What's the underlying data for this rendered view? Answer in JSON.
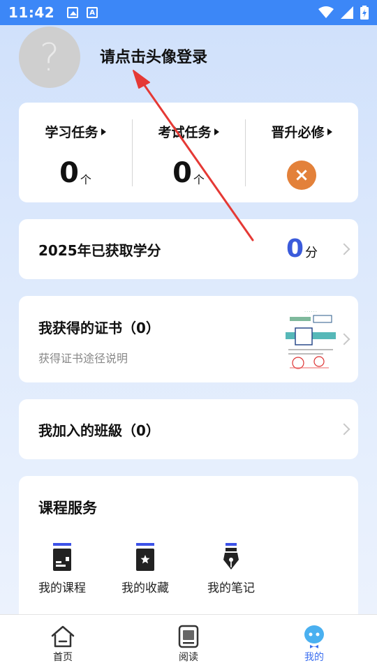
{
  "status_bar": {
    "time": "11:42",
    "icons": [
      "image-icon",
      "a-icon",
      "wifi-icon",
      "signal-icon",
      "battery-icon"
    ]
  },
  "header": {
    "avatar_placeholder": "?",
    "login_prompt": "请点击头像登录"
  },
  "tasks": [
    {
      "title": "学习任务",
      "count": "0",
      "unit": "个"
    },
    {
      "title": "考试任务",
      "count": "0",
      "unit": "个"
    },
    {
      "title": "晋升必修",
      "status": "×"
    }
  ],
  "credit": {
    "title": "2025年已获取学分",
    "value": "0",
    "unit": "分"
  },
  "certificate": {
    "title": "我获得的证书（0）",
    "subtitle": "获得证书途径说明"
  },
  "classes": {
    "title": "我加入的班級（0）"
  },
  "services": {
    "title": "课程服务",
    "items": [
      {
        "label": "我的课程",
        "icon": "course-book-icon"
      },
      {
        "label": "我的收藏",
        "icon": "favorite-book-icon"
      },
      {
        "label": "我的笔记",
        "icon": "pen-nib-icon"
      }
    ]
  },
  "tabbar": {
    "tabs": [
      {
        "label": "首页",
        "icon": "home-icon",
        "active": false
      },
      {
        "label": "阅读",
        "icon": "read-icon",
        "active": false
      },
      {
        "label": "我的",
        "icon": "profile-icon",
        "active": true
      }
    ]
  },
  "colors": {
    "status_bar": "#3c87f7",
    "accent": "#3c52e8",
    "credit_number": "#3b5bdb",
    "promotion_badge": "#e3813a",
    "annotation_arrow": "#e53935"
  }
}
